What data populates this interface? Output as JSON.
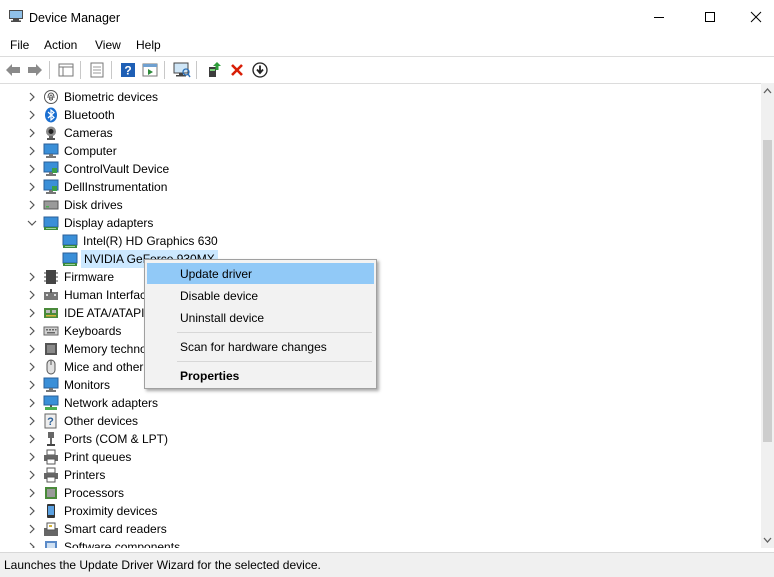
{
  "window": {
    "title": "Device Manager",
    "controls": {
      "minimize_icon": "minimize-icon",
      "maximize_icon": "maximize-icon",
      "close_icon": "close-icon"
    }
  },
  "menubar": {
    "items": [
      {
        "label": "File"
      },
      {
        "label": "Action"
      },
      {
        "label": "View"
      },
      {
        "label": "Help"
      }
    ]
  },
  "toolbar": {
    "buttons": [
      "back-icon",
      "forward-icon",
      "properties-grid-icon",
      "show-hidden-icon",
      "help-icon",
      "run-icon",
      "scan-hardware-icon",
      "add-driver-icon",
      "uninstall-device-icon",
      "update-driver-icon"
    ],
    "accent_red": "#d81e06",
    "accent_blue": "#1e5fb5"
  },
  "tree": {
    "items": [
      {
        "label": "Biometric devices",
        "icon": "fingerprint-icon",
        "state": "collapsed",
        "level": 0
      },
      {
        "label": "Bluetooth",
        "icon": "bluetooth-icon",
        "state": "collapsed",
        "level": 0
      },
      {
        "label": "Cameras",
        "icon": "camera-icon",
        "state": "collapsed",
        "level": 0
      },
      {
        "label": "Computer",
        "icon": "computer-icon",
        "state": "collapsed",
        "level": 0
      },
      {
        "label": "ControlVault Device",
        "icon": "controlvault-icon",
        "state": "collapsed",
        "level": 0
      },
      {
        "label": "DellInstrumentation",
        "icon": "dell-instrumentation-icon",
        "state": "collapsed",
        "level": 0
      },
      {
        "label": "Disk drives",
        "icon": "disk-drive-icon",
        "state": "collapsed",
        "level": 0
      },
      {
        "label": "Display adapters",
        "icon": "display-adapter-icon",
        "state": "expanded",
        "level": 0
      },
      {
        "label": "Intel(R) HD Graphics 630",
        "icon": "display-adapter-icon",
        "state": "leaf",
        "level": 1
      },
      {
        "label": "NVIDIA GeForce 930MX",
        "icon": "display-adapter-icon",
        "state": "selected",
        "level": 1
      },
      {
        "label": "Firmware",
        "icon": "firmware-icon",
        "state": "collapsed",
        "level": 0
      },
      {
        "label": "Human Interfac",
        "icon": "hid-icon",
        "state": "collapsed",
        "level": 0
      },
      {
        "label": "IDE ATA/ATAPI c",
        "icon": "ide-controller-icon",
        "state": "collapsed",
        "level": 0
      },
      {
        "label": "Keyboards",
        "icon": "keyboard-icon",
        "state": "collapsed",
        "level": 0
      },
      {
        "label": "Memory techno",
        "icon": "memory-icon",
        "state": "collapsed",
        "level": 0
      },
      {
        "label": "Mice and other",
        "icon": "mouse-icon",
        "state": "collapsed",
        "level": 0
      },
      {
        "label": "Monitors",
        "icon": "monitor-icon",
        "state": "collapsed",
        "level": 0
      },
      {
        "label": "Network adapters",
        "icon": "network-adapter-icon",
        "state": "collapsed",
        "level": 0
      },
      {
        "label": "Other devices",
        "icon": "other-devices-icon",
        "state": "collapsed",
        "level": 0
      },
      {
        "label": "Ports (COM & LPT)",
        "icon": "port-icon",
        "state": "collapsed",
        "level": 0
      },
      {
        "label": "Print queues",
        "icon": "printer-icon",
        "state": "collapsed",
        "level": 0
      },
      {
        "label": "Printers",
        "icon": "printer-icon",
        "state": "collapsed",
        "level": 0
      },
      {
        "label": "Processors",
        "icon": "processor-icon",
        "state": "collapsed",
        "level": 0
      },
      {
        "label": "Proximity devices",
        "icon": "proximity-icon",
        "state": "collapsed",
        "level": 0
      },
      {
        "label": "Smart card readers",
        "icon": "smart-card-icon",
        "state": "collapsed",
        "level": 0
      },
      {
        "label": "Software components",
        "icon": "software-component-icon",
        "state": "collapsed",
        "level": 0
      }
    ]
  },
  "context_menu": {
    "items": [
      {
        "label": "Update driver",
        "highlighted": true
      },
      {
        "label": "Disable device"
      },
      {
        "label": "Uninstall device"
      },
      {
        "label": "Scan for hardware changes"
      },
      {
        "label": "Properties",
        "bold": true
      }
    ],
    "highlight_color": "#91c9f7"
  },
  "statusbar": {
    "text": "Launches the Update Driver Wizard for the selected device."
  }
}
